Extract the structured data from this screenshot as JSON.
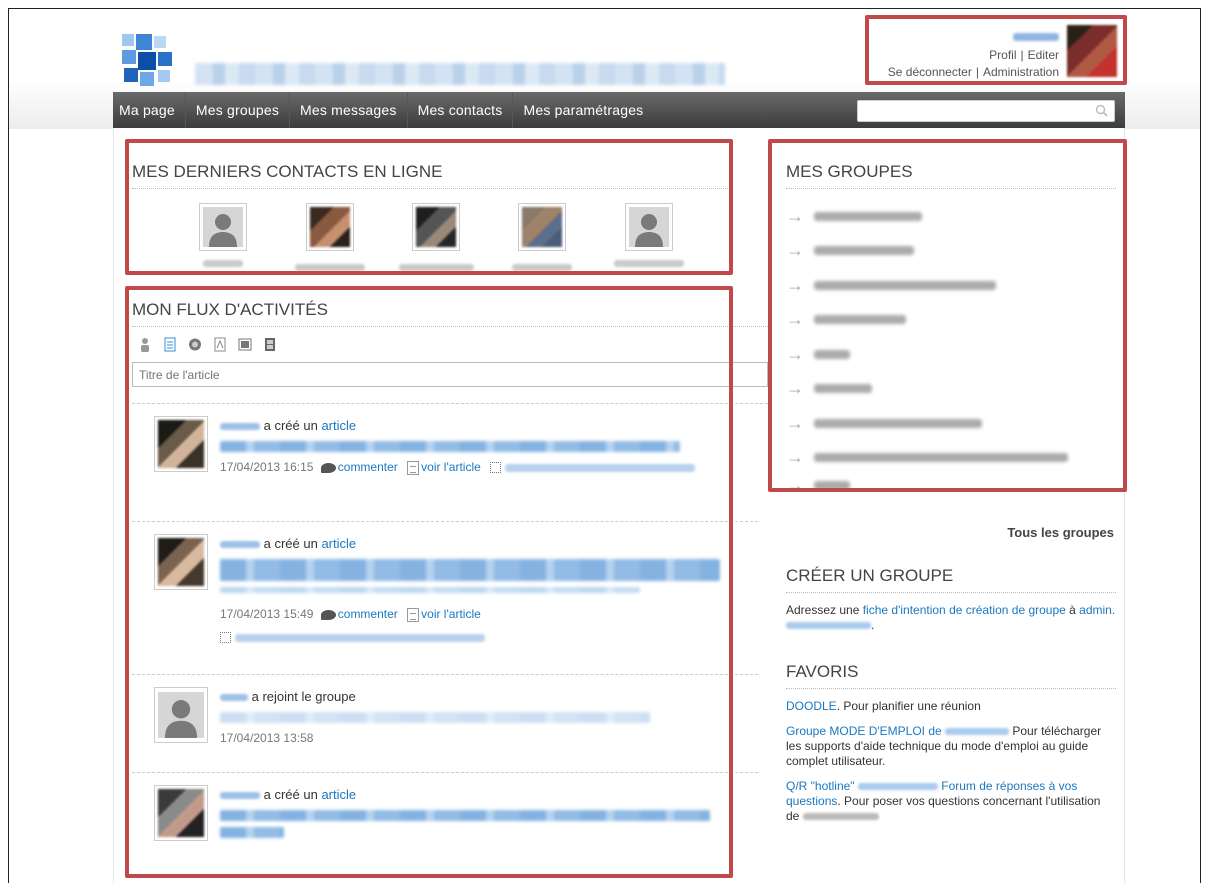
{
  "user": {
    "profile_label": "Profil",
    "edit_label": "Editer",
    "logout_label": "Se déconnecter",
    "admin_label": "Administration"
  },
  "nav": {
    "items": [
      "Ma page",
      "Mes groupes",
      "Mes messages",
      "Mes contacts",
      "Mes paramétrages"
    ],
    "search_placeholder": ""
  },
  "contacts": {
    "title": "MES DERNIERS CONTACTS EN LIGNE"
  },
  "activity": {
    "title": "MON FLUX D'ACTIVITÉS",
    "article_placeholder": "Titre de l'article",
    "toolbar_icons": [
      "person-icon",
      "document-icon",
      "link-icon",
      "pdf-icon",
      "image-icon",
      "film-icon"
    ],
    "items": [
      {
        "action": "a créé un",
        "link": "article",
        "time": "17/04/2013 16:15",
        "comment": "commenter",
        "view": "voir l'article"
      },
      {
        "action": "a créé un",
        "link": "article",
        "time": "17/04/2013 15:49",
        "comment": "commenter",
        "view": "voir l'article"
      },
      {
        "action": "a rejoint le groupe",
        "link": "",
        "time": "17/04/2013 13:58"
      },
      {
        "action": "a créé un",
        "link": "article"
      }
    ]
  },
  "groups": {
    "title": "MES GROUPES",
    "all_groups": "Tous les groupes"
  },
  "create_group": {
    "title": "CRÉER UN GROUPE",
    "text_before": "Adressez une ",
    "link": "fiche d'intention de création de groupe",
    "text_middle": " à ",
    "email_prefix": "admin."
  },
  "favorites": {
    "title": "FAVORIS",
    "doodle_link": "DOODLE",
    "doodle_text": ". Pour planifier une réunion",
    "guide_link": "Groupe MODE D'EMPLOI de",
    "guide_text_a": "Pour",
    "guide_text_b": "télécharger les supports d'aide technique du mode d'emploi au guide complet utilisateur.",
    "hotline_link": "Q/R \"hotline\"",
    "hotline_link2": "Forum de réponses à vos questions",
    "hotline_text": ". Pour poser vos questions concernant l'utilisation de"
  }
}
